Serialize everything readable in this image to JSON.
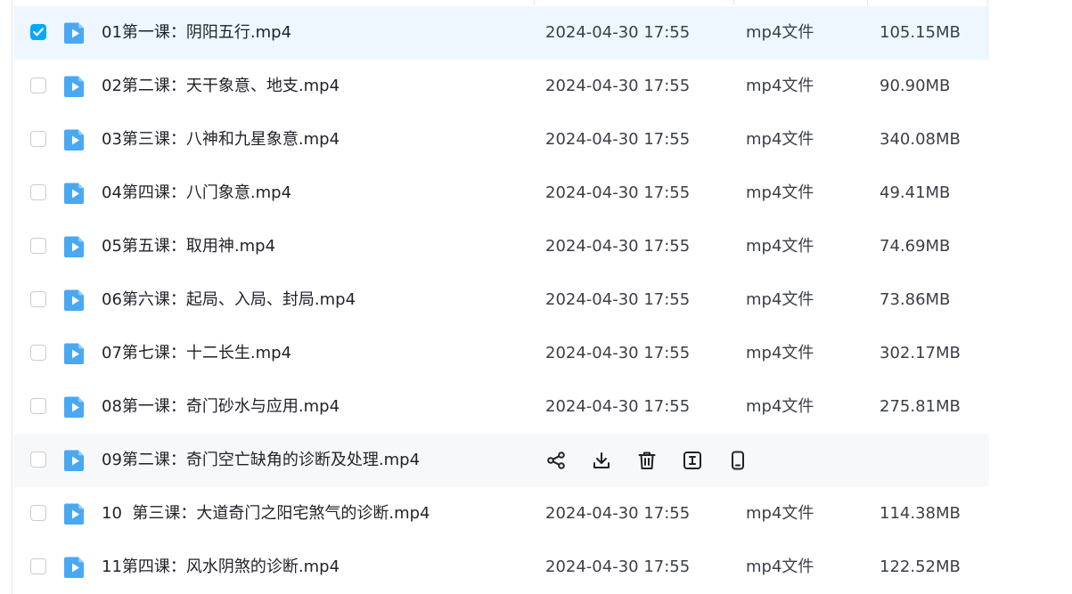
{
  "colors": {
    "accent": "#06a7ff",
    "selected_row_bg": "#eef7ff",
    "hover_row_bg": "#f7f8fa"
  },
  "files": [
    {
      "name": "01第一课：阴阳五行.mp4",
      "date": "2024-04-30 17:55",
      "type": "mp4文件",
      "size": "105.15MB",
      "checked": true
    },
    {
      "name": "02第二课：天干象意、地支.mp4",
      "date": "2024-04-30 17:55",
      "type": "mp4文件",
      "size": "90.90MB",
      "checked": false
    },
    {
      "name": "03第三课：八神和九星象意.mp4",
      "date": "2024-04-30 17:55",
      "type": "mp4文件",
      "size": "340.08MB",
      "checked": false
    },
    {
      "name": "04第四课：八门象意.mp4",
      "date": "2024-04-30 17:55",
      "type": "mp4文件",
      "size": "49.41MB",
      "checked": false
    },
    {
      "name": "05第五课：取用神.mp4",
      "date": "2024-04-30 17:55",
      "type": "mp4文件",
      "size": "74.69MB",
      "checked": false
    },
    {
      "name": "06第六课：起局、入局、封局.mp4",
      "date": "2024-04-30 17:55",
      "type": "mp4文件",
      "size": "73.86MB",
      "checked": false
    },
    {
      "name": "07第七课：十二长生.mp4",
      "date": "2024-04-30 17:55",
      "type": "mp4文件",
      "size": "302.17MB",
      "checked": false
    },
    {
      "name": "08第一课：奇门砂水与应用.mp4",
      "date": "2024-04-30 17:55",
      "type": "mp4文件",
      "size": "275.81MB",
      "checked": false
    },
    {
      "name": "09第二课：奇门空亡缺角的诊断及处理.mp4",
      "hovered": true,
      "checked": false,
      "actions": [
        "share-icon",
        "download-icon",
        "delete-icon",
        "rename-icon",
        "phone-icon"
      ]
    },
    {
      "name": "10  第三课：大道奇门之阳宅煞气的诊断.mp4",
      "date": "2024-04-30 17:55",
      "type": "mp4文件",
      "size": "114.38MB",
      "checked": false
    },
    {
      "name": "11第四课：风水阴煞的诊断.mp4",
      "date": "2024-04-30 17:55",
      "type": "mp4文件",
      "size": "122.52MB",
      "checked": false
    }
  ]
}
